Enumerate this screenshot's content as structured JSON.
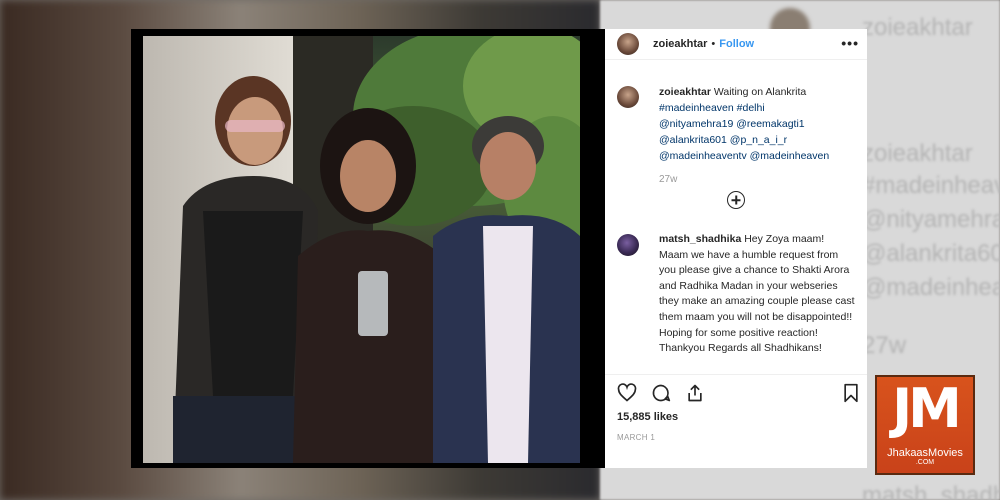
{
  "background": {
    "handle": "zoieakhtar",
    "tags": [
      "#madeinheav",
      "@nityamehra",
      "@alankrita60",
      "@madeinhea"
    ],
    "time": "27w",
    "commenter": "matsh_shadh"
  },
  "post": {
    "header": {
      "username": "zoieakhtar",
      "separator": "•",
      "follow_label": "Follow",
      "more_label": "•••"
    },
    "caption": {
      "username": "zoieakhtar",
      "text": "Waiting on Alankrita",
      "line2": "#madeinheaven #delhi",
      "line3": "@nityamehra19 @reemakagti1",
      "line4": "@alankrita601 @p_n_a_i_r",
      "line5": "@madeinheaventv @madeinheaven"
    },
    "caption_time": "27w",
    "load_more_icon": "plus-circle-icon",
    "comment": {
      "username": "matsh_shadhika",
      "text": "Hey Zoya maam! Maam we have a humble request from you please give a chance to Shakti Arora and Radhika Madan in your webseries they make an amazing couple please cast them maam you will not be disappointed!! Hoping for some positive reaction! Thankyou Regards all Shadhikans!"
    },
    "actions": {
      "like_icon": "heart-icon",
      "comment_icon": "comment-icon",
      "share_icon": "share-icon",
      "save_icon": "bookmark-icon"
    },
    "likes": "15,885 likes",
    "date": "MARCH 1"
  },
  "watermark": {
    "mark": "JM",
    "name": "JhakaasMovies",
    "domain": ".COM",
    "color": "#d04a1b"
  }
}
